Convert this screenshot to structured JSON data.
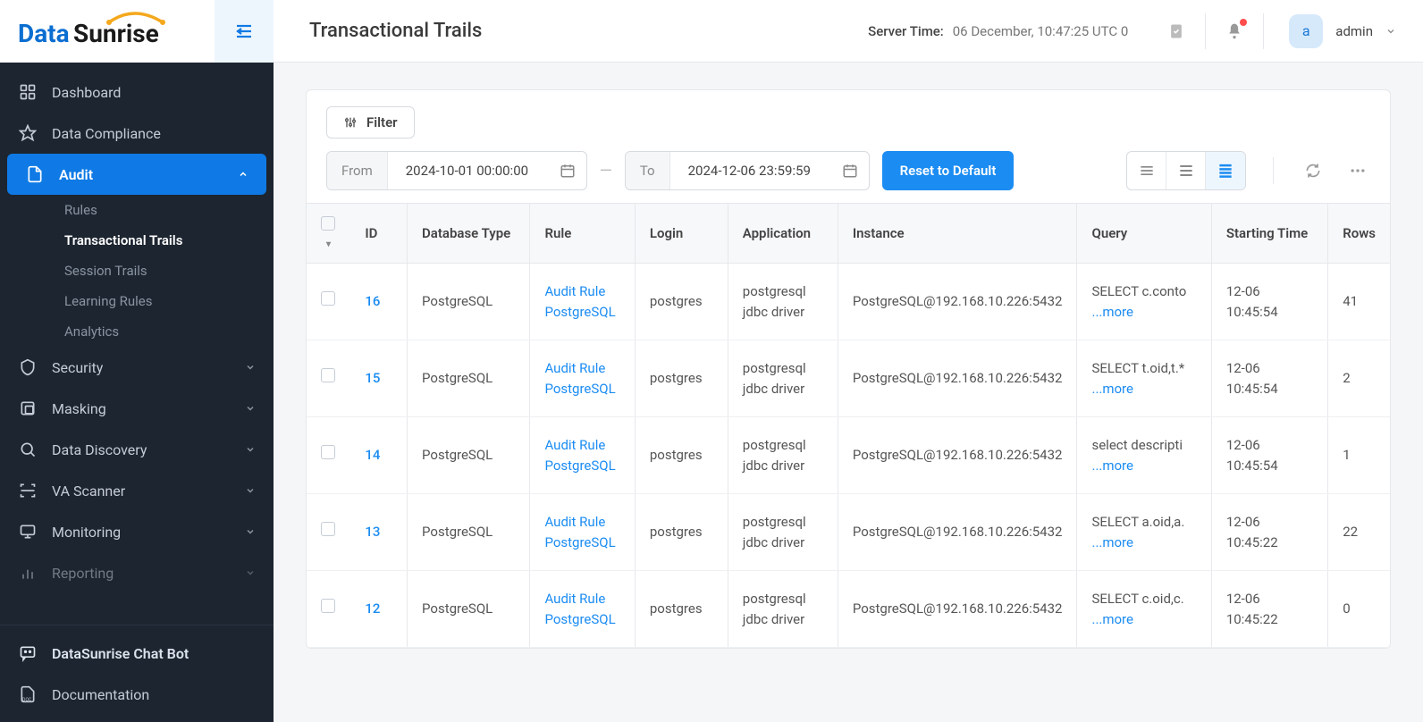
{
  "logo": {
    "part1": "Data",
    "part2": "Sunrise"
  },
  "header": {
    "title": "Transactional Trails",
    "server_time_label": "Server Time:",
    "server_time_value": "06 December, 10:47:25  UTC 0",
    "user": {
      "initial": "a",
      "name": "admin"
    }
  },
  "sidebar": {
    "items": [
      {
        "label": "Dashboard"
      },
      {
        "label": "Data Compliance"
      },
      {
        "label": "Audit",
        "active": true
      },
      {
        "label": "Security"
      },
      {
        "label": "Masking"
      },
      {
        "label": "Data Discovery"
      },
      {
        "label": "VA Scanner"
      },
      {
        "label": "Monitoring"
      },
      {
        "label": "Reporting"
      }
    ],
    "audit_sub": [
      {
        "label": "Rules"
      },
      {
        "label": "Transactional Trails",
        "current": true
      },
      {
        "label": "Session Trails"
      },
      {
        "label": "Learning Rules"
      },
      {
        "label": "Analytics"
      }
    ],
    "bottom": {
      "chatbot": "DataSunrise Chat Bot",
      "doc": "Documentation"
    }
  },
  "toolbar": {
    "filter": "Filter",
    "from_label": "From",
    "from_value": "2024-10-01 00:00:00",
    "to_label": "To",
    "to_value": "2024-12-06 23:59:59",
    "reset": "Reset to Default"
  },
  "table": {
    "headers": {
      "id": "ID",
      "db_type": "Database Type",
      "rule": "Rule",
      "login": "Login",
      "application": "Application",
      "instance": "Instance",
      "query": "Query",
      "start": "Starting Time",
      "rows": "Rows"
    },
    "more": "...more",
    "rows": [
      {
        "id": "16",
        "db": "PostgreSQL",
        "rule1": "Audit Rule",
        "rule2": "PostgreSQL",
        "login": "postgres",
        "app": "postgresql jdbc driver",
        "instance": "PostgreSQL@192.168.10.226:5432",
        "query": "SELECT c.conto",
        "start": "12-06 10:45:54",
        "rows": "41"
      },
      {
        "id": "15",
        "db": "PostgreSQL",
        "rule1": "Audit Rule",
        "rule2": "PostgreSQL",
        "login": "postgres",
        "app": "postgresql jdbc driver",
        "instance": "PostgreSQL@192.168.10.226:5432",
        "query": "SELECT t.oid,t.*",
        "start": "12-06 10:45:54",
        "rows": "2"
      },
      {
        "id": "14",
        "db": "PostgreSQL",
        "rule1": "Audit Rule",
        "rule2": "PostgreSQL",
        "login": "postgres",
        "app": "postgresql jdbc driver",
        "instance": "PostgreSQL@192.168.10.226:5432",
        "query": "select descripti",
        "start": "12-06 10:45:54",
        "rows": "1"
      },
      {
        "id": "13",
        "db": "PostgreSQL",
        "rule1": "Audit Rule",
        "rule2": "PostgreSQL",
        "login": "postgres",
        "app": "postgresql jdbc driver",
        "instance": "PostgreSQL@192.168.10.226:5432",
        "query": "SELECT a.oid,a.",
        "start": "12-06 10:45:22",
        "rows": "22"
      },
      {
        "id": "12",
        "db": "PostgreSQL",
        "rule1": "Audit Rule",
        "rule2": "PostgreSQL",
        "login": "postgres",
        "app": "postgresql jdbc driver",
        "instance": "PostgreSQL@192.168.10.226:5432",
        "query": "SELECT c.oid,c.",
        "start": "12-06 10:45:22",
        "rows": "0"
      }
    ]
  }
}
